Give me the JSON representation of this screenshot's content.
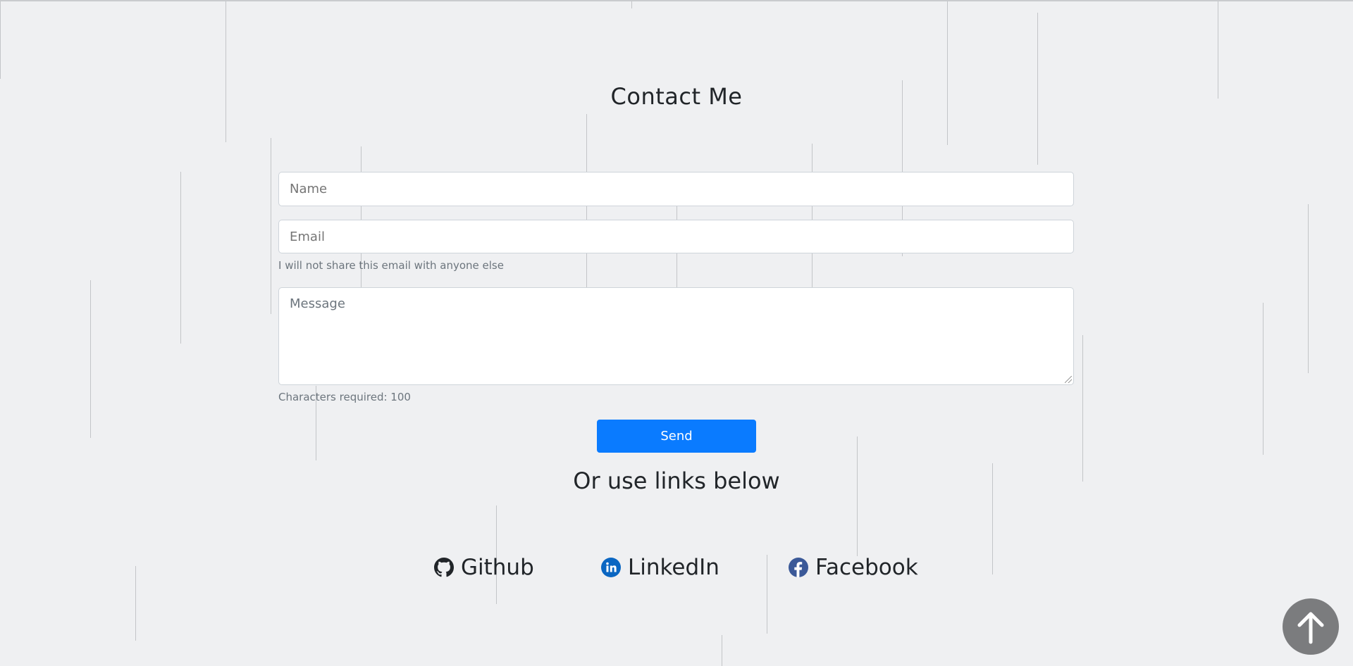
{
  "contact": {
    "title": "Contact Me",
    "name_placeholder": "Name",
    "email_placeholder": "Email",
    "email_help": "I will not share this email with anyone else",
    "message_placeholder": "Message",
    "message_help": "Characters required: 100",
    "send_label": "Send"
  },
  "links": {
    "heading": "Or use links below",
    "items": [
      {
        "label": "Github",
        "icon": "github-icon"
      },
      {
        "label": "LinkedIn",
        "icon": "linkedin-icon"
      },
      {
        "label": "Facebook",
        "icon": "facebook-icon"
      }
    ]
  },
  "scroll_top": {
    "icon": "arrow-up-icon"
  },
  "colors": {
    "background": "#eff0f2",
    "primary": "#0a7bff",
    "linkedin": "#0a66c2",
    "facebook": "#3b5998",
    "scroll_button": "#7b7c7e"
  }
}
